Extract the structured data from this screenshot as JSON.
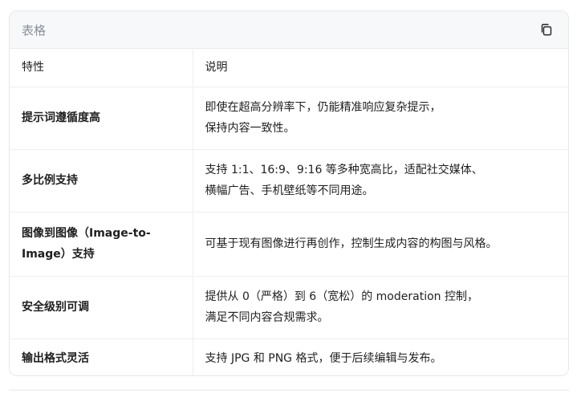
{
  "card": {
    "title": "表格",
    "copy_icon": "copy-icon"
  },
  "table": {
    "headers": [
      "特性",
      "说明"
    ],
    "rows": [
      {
        "feature": "提示词遵循度高",
        "desc_lines": [
          "即使在超高分辨率下，仍能精准响应复杂提示，",
          "保持内容一致性。"
        ]
      },
      {
        "feature": "多比例支持",
        "desc_lines": [
          "支持 1:1、16:9、9:16 等多种宽高比，适配社交媒体、",
          "横幅广告、手机壁纸等不同用途。"
        ]
      },
      {
        "feature_lines": [
          "图像到图像（Image-to-",
          "Image）支持"
        ],
        "desc_lines": [
          "可基于现有图像进行再创作，控制生成内容的构图与风格。"
        ]
      },
      {
        "feature": "安全级别可调",
        "desc_lines": [
          "提供从 0（严格）到 6（宽松）的 moderation 控制，",
          "满足不同内容合规需求。"
        ]
      },
      {
        "feature": "输出格式灵活",
        "desc_lines": [
          "支持 JPG 和 PNG 格式，便于后续编辑与发布。"
        ]
      }
    ]
  }
}
